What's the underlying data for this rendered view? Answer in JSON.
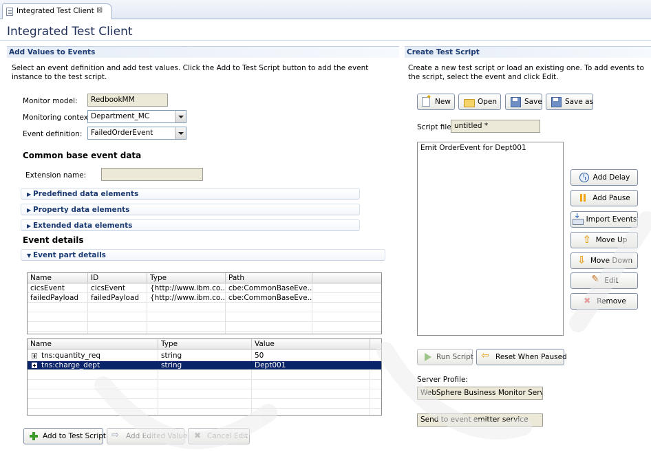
{
  "tab": {
    "label": "Integrated Test Client",
    "close_glyph": "⊠"
  },
  "editor_title": "Integrated Test Client",
  "left": {
    "header": "Add Values to Events",
    "description": "Select an event definition and add test values. Click the Add to Test Script button to add the event instance to the test script.",
    "monitor_model_label": "Monitor model:",
    "monitor_model_value": "RedbookMM",
    "monitoring_context_label": "Monitoring context:",
    "monitoring_context_value": "Department_MC",
    "event_definition_label": "Event definition:",
    "event_definition_value": "FailedOrderEvent",
    "cbe_heading": "Common base event data",
    "extension_name_label": "Extension name:",
    "extension_name_value": "",
    "sections": [
      "Predefined data elements",
      "Property data elements",
      "Extended data elements"
    ],
    "event_details_heading": "Event details",
    "event_part_details": "Event part details",
    "parts_table": {
      "columns": [
        "Name",
        "ID",
        "Type",
        "Path"
      ],
      "rows": [
        [
          "cicsEvent",
          "cicsEvent",
          "{http://www.ibm.co...",
          "cbe:CommonBaseEve..."
        ],
        [
          "failedPayload",
          "failedPayload",
          "{http://www.ibm.co...",
          "cbe:CommonBaseEve..."
        ]
      ]
    },
    "values_table": {
      "columns": [
        "Name",
        "Type",
        "Value"
      ],
      "rows": [
        [
          "tns:quantity_req",
          "string",
          "50"
        ],
        [
          "tns:charge_dept",
          "string",
          "Dept001"
        ]
      ],
      "selected_row": 1
    },
    "buttons": {
      "add_to_test_script": "Add to Test Script",
      "add_edited_values": "Add Edited Values",
      "cancel_edit": "Cancel Edit"
    }
  },
  "right": {
    "header": "Create Test Script",
    "description": "Create a new test script or load an existing one. To add events to the script, select the event and click Edit.",
    "toolbar": {
      "new": "New",
      "open": "Open",
      "save": "Save",
      "save_as": "Save as"
    },
    "script_file_label": "Script file:",
    "script_file_value": "untitled *",
    "script_items": [
      "Emit OrderEvent for Dept001"
    ],
    "side_buttons": {
      "add_delay": "Add Delay",
      "add_pause": "Add Pause",
      "import_events": "Import Events",
      "move_up": "Move Up",
      "move_down": "Move Down",
      "edit": "Edit",
      "remove": "Remove"
    },
    "run_script": "Run Script",
    "reset_when_paused": "Reset When Paused",
    "server_profile_label": "Server Profile:",
    "server_profile_value": "WebSphere Business Monitor Server \\",
    "send_to_value": "Send to event emitter service"
  },
  "colors": {
    "section_header_text": "#1b3a72",
    "selection": "#0a246a",
    "title": "#22325a"
  }
}
